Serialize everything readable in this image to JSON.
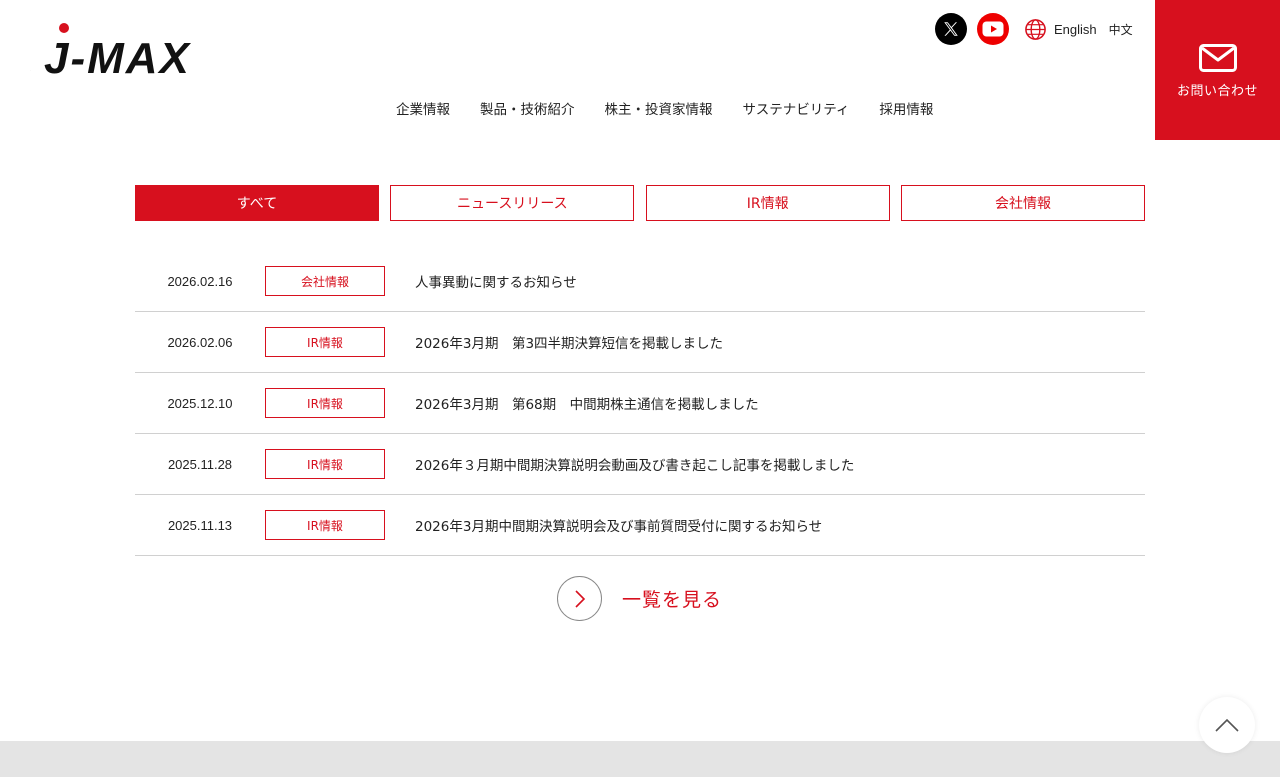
{
  "header": {
    "logo_text": "J-MAX",
    "sns": [
      {
        "name": "x-icon"
      },
      {
        "name": "youtube-icon"
      }
    ],
    "lang": {
      "english": "English",
      "chinese": "中文"
    },
    "contact_label": "お問い合わせ"
  },
  "nav": {
    "items": [
      {
        "label": "企業情報"
      },
      {
        "label": "製品・技術紹介"
      },
      {
        "label": "株主・投資家情報"
      },
      {
        "label": "サステナビリティ"
      },
      {
        "label": "採用情報"
      }
    ]
  },
  "tabs": [
    {
      "label": "すべて",
      "active": true
    },
    {
      "label": "ニュースリリース",
      "active": false
    },
    {
      "label": "IR情報",
      "active": false
    },
    {
      "label": "会社情報",
      "active": false
    }
  ],
  "news": [
    {
      "date": "2026.02.16",
      "category": "会社情報",
      "title": "人事異動に関するお知らせ"
    },
    {
      "date": "2026.02.06",
      "category": "IR情報",
      "title": "2026年3月期　第3四半期決算短信を掲載しました"
    },
    {
      "date": "2025.12.10",
      "category": "IR情報",
      "title": "2026年3月期　第68期　中間期株主通信を掲載しました"
    },
    {
      "date": "2025.11.28",
      "category": "IR情報",
      "title": "2026年３月期中間期決算説明会動画及び書き起こし記事を掲載しました"
    },
    {
      "date": "2025.11.13",
      "category": "IR情報",
      "title": "2026年3月期中間期決算説明会及び事前質問受付に関するお知らせ"
    }
  ],
  "more_label": "一覧を見る",
  "colors": {
    "accent": "#d7101e",
    "divider": "#d0d0d0",
    "footer": "#e4e4e4"
  }
}
